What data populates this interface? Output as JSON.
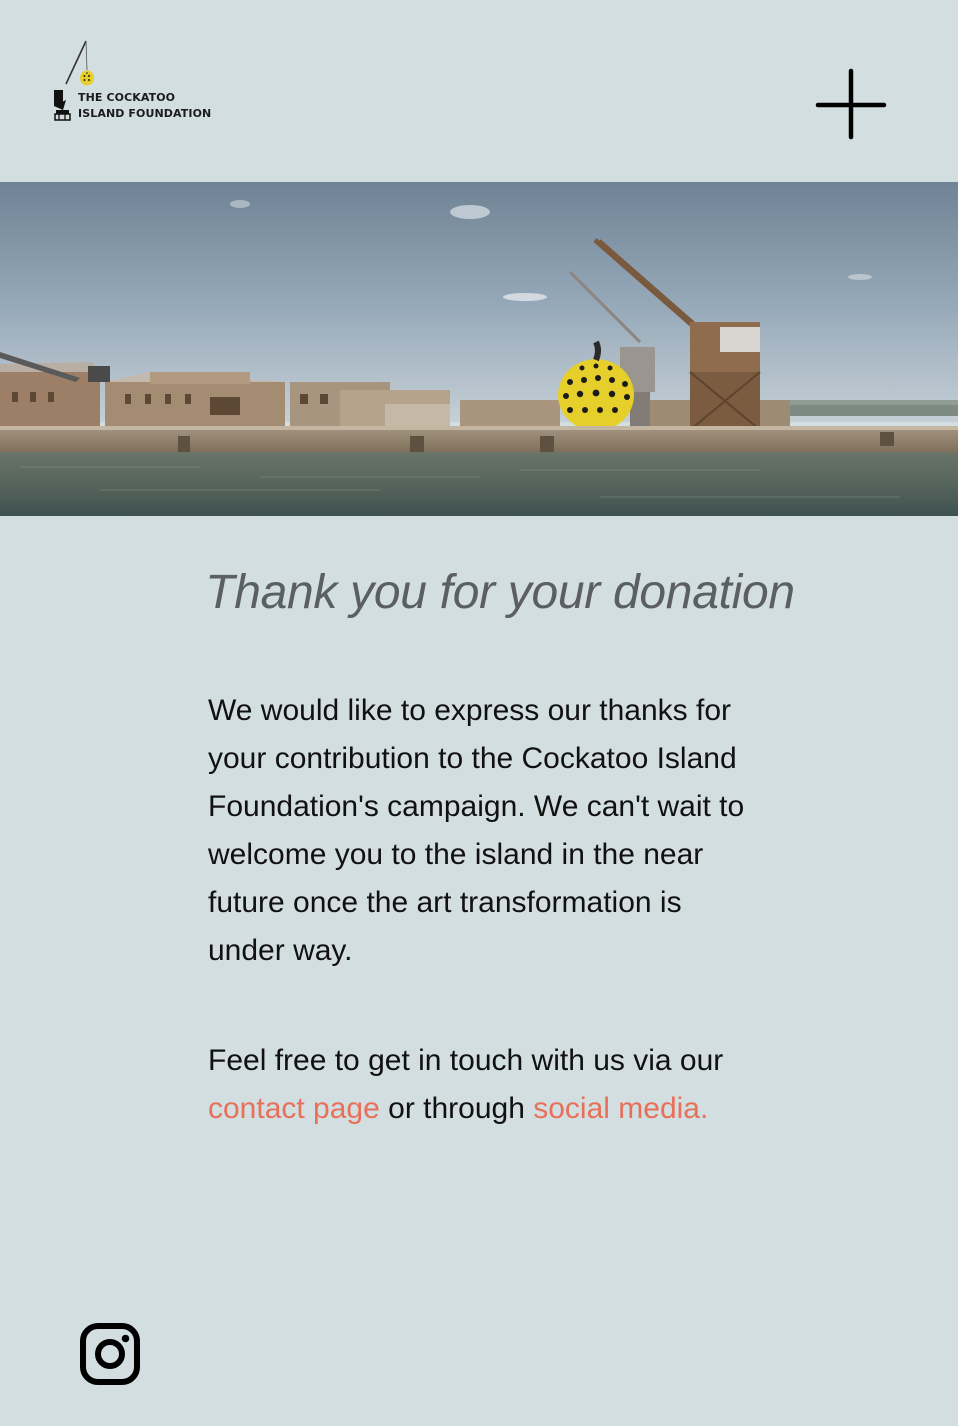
{
  "header": {
    "logo": {
      "line1": "THE COCKATOO",
      "line2": "ISLAND FOUNDATION",
      "icon": "crane-pumpkin-icon"
    },
    "menu_icon": "plus-icon"
  },
  "hero": {
    "description_icon": "pumpkin-icon"
  },
  "main": {
    "title": "Thank you for your donation",
    "paragraph1": "We would like to express our thanks for your contribution to the Cockatoo Island Foundation's campaign. We can't wait to welcome you to the island in the near future once the art transformation is under way.",
    "paragraph2_before": "Feel free to get in touch with us via our ",
    "contact_link": "contact page",
    "paragraph2_middle": " or through ",
    "social_link": "social media."
  },
  "footer": {
    "social_icon": "instagram-icon"
  },
  "colors": {
    "background": "#d3dee0",
    "link": "#e8705a",
    "title": "#5b5f61",
    "text": "#111111",
    "pumpkin": "#e6cf2a"
  }
}
